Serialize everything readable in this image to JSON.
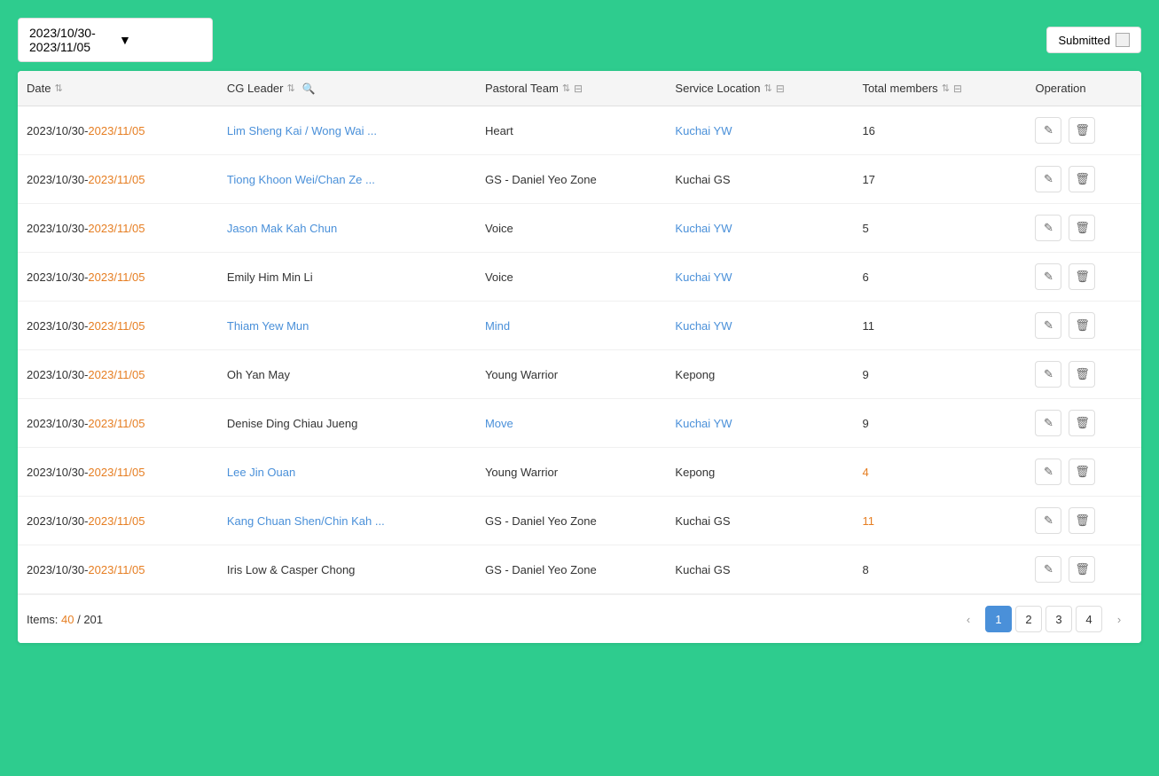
{
  "topBar": {
    "dateRange": "2023/10/30-2023/11/05",
    "submittedLabel": "Submitted"
  },
  "table": {
    "columns": [
      {
        "key": "date",
        "label": "Date",
        "sortable": true,
        "searchable": false,
        "filterable": false
      },
      {
        "key": "cgLeader",
        "label": "CG Leader",
        "sortable": true,
        "searchable": true,
        "filterable": false
      },
      {
        "key": "pastoralTeam",
        "label": "Pastoral Team",
        "sortable": true,
        "searchable": false,
        "filterable": true
      },
      {
        "key": "serviceLocation",
        "label": "Service Location",
        "sortable": true,
        "searchable": false,
        "filterable": true
      },
      {
        "key": "totalMembers",
        "label": "Total members",
        "sortable": true,
        "searchable": false,
        "filterable": true
      },
      {
        "key": "operation",
        "label": "Operation",
        "sortable": false,
        "searchable": false,
        "filterable": false
      }
    ],
    "rows": [
      {
        "date": "2023/10/30-2023/11/05",
        "dateHighlight": true,
        "cgLeader": "Lim Sheng Kai / Wong Wai ...",
        "cgLeaderLink": true,
        "pastoralTeam": "Heart",
        "pastoralLink": false,
        "serviceLocation": "Kuchai YW",
        "locationLink": true,
        "totalMembers": 16,
        "totalHighlight": false
      },
      {
        "date": "2023/10/30-2023/11/05",
        "dateHighlight": true,
        "cgLeader": "Tiong Khoon Wei/Chan Ze ...",
        "cgLeaderLink": true,
        "pastoralTeam": "GS - Daniel Yeo Zone",
        "pastoralLink": false,
        "serviceLocation": "Kuchai GS",
        "locationLink": false,
        "totalMembers": 17,
        "totalHighlight": false
      },
      {
        "date": "2023/10/30-2023/11/05",
        "dateHighlight": true,
        "cgLeader": "Jason Mak Kah Chun",
        "cgLeaderLink": true,
        "pastoralTeam": "Voice",
        "pastoralLink": false,
        "serviceLocation": "Kuchai YW",
        "locationLink": true,
        "totalMembers": 5,
        "totalHighlight": false
      },
      {
        "date": "2023/10/30-2023/11/05",
        "dateHighlight": true,
        "cgLeader": "Emily Him Min Li",
        "cgLeaderLink": false,
        "pastoralTeam": "Voice",
        "pastoralLink": false,
        "serviceLocation": "Kuchai YW",
        "locationLink": true,
        "totalMembers": 6,
        "totalHighlight": false
      },
      {
        "date": "2023/10/30-2023/11/05",
        "dateHighlight": true,
        "cgLeader": "Thiam Yew Mun",
        "cgLeaderLink": true,
        "pastoralTeam": "Mind",
        "pastoralLink": true,
        "serviceLocation": "Kuchai YW",
        "locationLink": true,
        "totalMembers": 11,
        "totalHighlight": false
      },
      {
        "date": "2023/10/30-2023/11/05",
        "dateHighlight": true,
        "cgLeader": "Oh Yan May",
        "cgLeaderLink": false,
        "pastoralTeam": "Young Warrior",
        "pastoralLink": false,
        "serviceLocation": "Kepong",
        "locationLink": false,
        "totalMembers": 9,
        "totalHighlight": false
      },
      {
        "date": "2023/10/30-2023/11/05",
        "dateHighlight": true,
        "cgLeader": "Denise Ding Chiau Jueng",
        "cgLeaderLink": false,
        "pastoralTeam": "Move",
        "pastoralLink": true,
        "serviceLocation": "Kuchai YW",
        "locationLink": true,
        "totalMembers": 9,
        "totalHighlight": false
      },
      {
        "date": "2023/10/30-2023/11/05",
        "dateHighlight": true,
        "cgLeader": "Lee Jin Ouan",
        "cgLeaderLink": true,
        "pastoralTeam": "Young Warrior",
        "pastoralLink": false,
        "serviceLocation": "Kepong",
        "locationLink": false,
        "totalMembers": 4,
        "totalHighlight": true
      },
      {
        "date": "2023/10/30-2023/11/05",
        "dateHighlight": true,
        "cgLeader": "Kang Chuan Shen/Chin Kah ...",
        "cgLeaderLink": true,
        "pastoralTeam": "GS - Daniel Yeo Zone",
        "pastoralLink": false,
        "serviceLocation": "Kuchai GS",
        "locationLink": false,
        "totalMembers": 11,
        "totalHighlight": true
      },
      {
        "date": "2023/10/30-2023/11/05",
        "dateHighlight": true,
        "cgLeader": "Iris Low & Casper Chong",
        "cgLeaderLink": false,
        "pastoralTeam": "GS - Daniel Yeo Zone",
        "pastoralLink": false,
        "serviceLocation": "Kuchai GS",
        "locationLink": false,
        "totalMembers": 8,
        "totalHighlight": false
      }
    ]
  },
  "footer": {
    "itemsLabel": "Items: ",
    "currentCount": "40",
    "separator": " / ",
    "totalCount": "201"
  },
  "pagination": {
    "currentPage": 1,
    "pages": [
      1,
      2,
      3,
      4
    ],
    "prevLabel": "‹",
    "nextLabel": "›"
  }
}
